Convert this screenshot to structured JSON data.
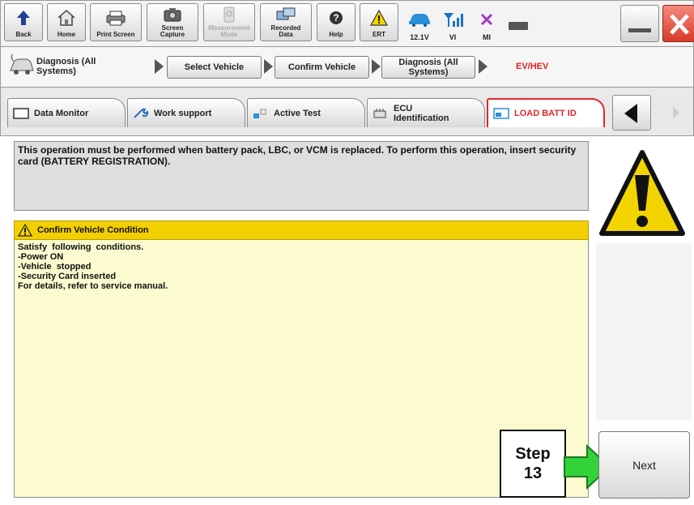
{
  "toolbar": {
    "back_label": "Back",
    "home_label": "Home",
    "print_label": "Print Screen",
    "capture_label": "Screen\nCapture",
    "measurement_label": "Measurement\nMode",
    "recorded_label": "Recorded\nData",
    "help_label": "Help",
    "ert_label": "ERT",
    "voltage_label": "12.1V",
    "vi_label": "VI",
    "mi_label": "MI"
  },
  "breadcrumb": {
    "first_label": "Diagnosis (All\nSystems)",
    "select_vehicle": "Select Vehicle",
    "confirm_vehicle": "Confirm Vehicle",
    "diagnosis_all": "Diagnosis (All\nSystems)",
    "current": "EV/HEV"
  },
  "tabs": [
    {
      "label": "Data Monitor"
    },
    {
      "label": "Work support"
    },
    {
      "label": "Active Test"
    },
    {
      "label": "ECU\nIdentification"
    },
    {
      "label": "LOAD BATT ID"
    }
  ],
  "message": "This operation must be performed when battery pack, LBC, or VCM is replaced. To perform this operation, insert security card (BATTERY REGISTRATION).",
  "condition": {
    "header": "Confirm Vehicle Condition",
    "lines": [
      "Satisfy  following  conditions.",
      "-Power ON",
      "-Vehicle  stopped",
      "-Security Card inserted",
      "For details, refer to service manual."
    ]
  },
  "step": {
    "word": "Step",
    "number": "13"
  },
  "next_label": "Next",
  "colors": {
    "accent_red": "#e0282d",
    "condition_header": "#f2cf00",
    "condition_body": "#fcfbcf",
    "arrow_green": "#34d23a",
    "warning_yellow": "#f4d400"
  }
}
